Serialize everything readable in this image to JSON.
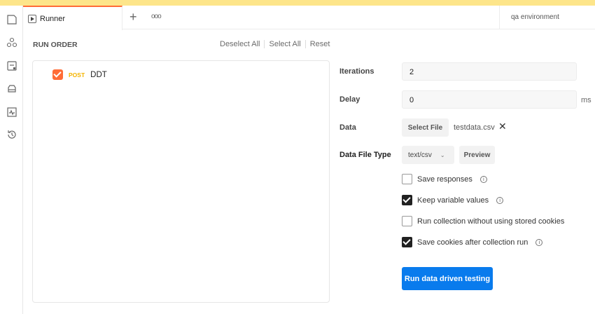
{
  "sidebar": {
    "icons": [
      "collections-icon",
      "apis-icon",
      "mock-servers-icon",
      "environments-icon",
      "monitors-icon",
      "history-icon"
    ]
  },
  "tabs": {
    "active_label": "Runner",
    "new_tab": "+",
    "more": "ooo",
    "environment": "qa environment"
  },
  "run_order": {
    "title": "RUN ORDER",
    "deselect_all": "Deselect All",
    "select_all": "Select All",
    "reset": "Reset",
    "requests": [
      {
        "method": "POST",
        "name": "DDT",
        "checked": true
      }
    ]
  },
  "settings": {
    "iterations_label": "Iterations",
    "iterations": "2",
    "delay_label": "Delay",
    "delay": "0",
    "delay_unit": "ms",
    "data_label": "Data",
    "select_file": "Select File",
    "file_name": "testdata.csv",
    "clear_file": "✕",
    "file_type_label": "Data File Type",
    "file_type": "text/csv",
    "preview": "Preview",
    "options": [
      {
        "label": "Save responses",
        "checked": false,
        "info": true
      },
      {
        "label": "Keep variable values",
        "checked": true,
        "info": true
      },
      {
        "label": "Run collection without using stored cookies",
        "checked": false,
        "info": false
      },
      {
        "label": "Save cookies after collection run",
        "checked": true,
        "info": true
      }
    ],
    "run_button": "Run data driven testing"
  },
  "colors": {
    "accent": "#ff6c37",
    "primary": "#097bed",
    "method_post": "#f4b400"
  }
}
